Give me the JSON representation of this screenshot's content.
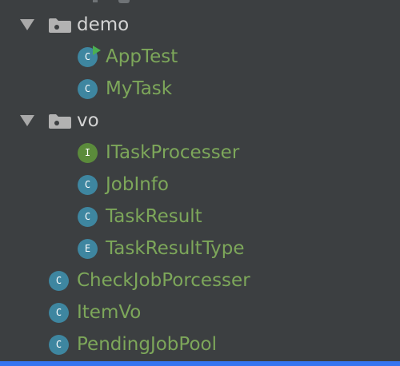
{
  "colors": {
    "background": "#3c3f41",
    "package_text": "#d4d4d4",
    "source_text": "#7da75a",
    "class_icon": "#3e86a0",
    "interface_icon": "#5b8b3b",
    "enum_icon": "#3e86a0",
    "run_marker": "#4caf50",
    "selection_bar": "#3574f0"
  },
  "tree": {
    "items": [
      {
        "label": "demo",
        "kind": "package",
        "icon": "package-folder-icon",
        "expanded": true
      },
      {
        "label": "AppTest",
        "kind": "class",
        "icon": "class-icon",
        "badge": "C",
        "runnable": true
      },
      {
        "label": "MyTask",
        "kind": "class",
        "icon": "class-icon",
        "badge": "C"
      },
      {
        "label": "vo",
        "kind": "package",
        "icon": "package-folder-icon",
        "expanded": true
      },
      {
        "label": "ITaskProcesser",
        "kind": "interface",
        "icon": "interface-icon",
        "badge": "I"
      },
      {
        "label": "JobInfo",
        "kind": "class",
        "icon": "class-icon",
        "badge": "C"
      },
      {
        "label": "TaskResult",
        "kind": "class",
        "icon": "class-icon",
        "badge": "C"
      },
      {
        "label": "TaskResultType",
        "kind": "enum",
        "icon": "enum-icon",
        "badge": "E"
      },
      {
        "label": "CheckJobPorcesser",
        "kind": "class",
        "icon": "class-icon",
        "badge": "C"
      },
      {
        "label": "ItemVo",
        "kind": "class",
        "icon": "class-icon",
        "badge": "C"
      },
      {
        "label": "PendingJobPool",
        "kind": "class",
        "icon": "class-icon",
        "badge": "C"
      }
    ]
  }
}
